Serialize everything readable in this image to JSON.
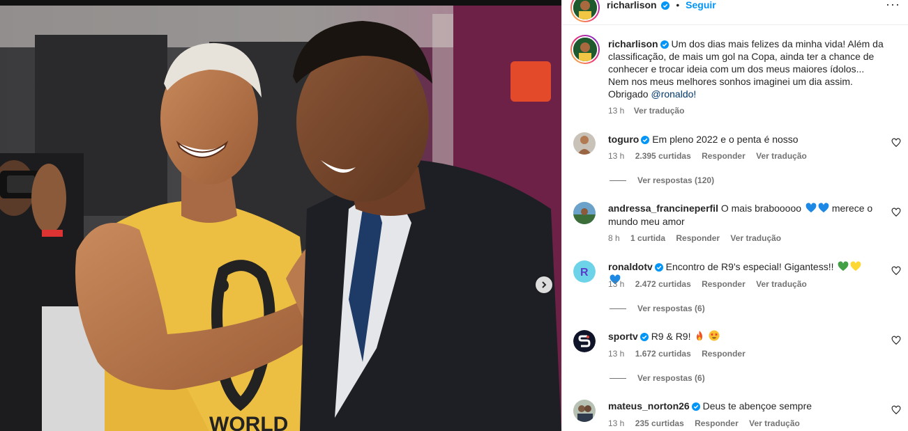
{
  "post": {
    "author": "richarlison",
    "follow_label": "Seguir",
    "caption": "Um dos dias mais felizes da minha vida! Além da classificação, de mais um gol na Copa, ainda ter a chance de conhecer e trocar ideia com um dos meus maiores ídolos... Nem nos meus melhores sonhos imaginei um dia assim. Obrigado",
    "mention": "@ronaldo!",
    "time": "13 h",
    "translate": "Ver tradução"
  },
  "comments": [
    {
      "user": "toguro",
      "text": "Em pleno 2022 e o penta é nosso",
      "time": "13 h",
      "likes": "2.395 curtidas",
      "reply": "Responder",
      "translate": "Ver tradução",
      "replies": "Ver respostas (120)"
    },
    {
      "user": "andressa_francineperfil",
      "text": "O mais brabooooo",
      "text_after": "merece o mundo meu amor",
      "time": "8 h",
      "likes": "1 curtida",
      "reply": "Responder",
      "translate": "Ver tradução"
    },
    {
      "user": "ronaldotv",
      "text": "Encontro de R9's especial! Gigantess!!",
      "time": "13 h",
      "likes": "2.472 curtidas",
      "reply": "Responder",
      "translate": "Ver tradução",
      "replies": "Ver respostas (6)"
    },
    {
      "user": "sportv",
      "text": "R9 & R9!",
      "time": "13 h",
      "likes": "1.672 curtidas",
      "reply": "Responder",
      "replies": "Ver respostas (6)"
    },
    {
      "user": "mateus_norton26",
      "text": "Deus te abençoe sempre",
      "time": "13 h",
      "likes": "235 curtidas",
      "reply": "Responder",
      "translate": "Ver tradução"
    }
  ],
  "colors": {
    "accent": "#0095f6",
    "verified": "#0095f6",
    "meta": "#737373"
  },
  "icons": [
    "verified-badge-icon",
    "more-options-icon",
    "heart-icon",
    "chevron-right-icon",
    "blue-heart-icon",
    "green-heart-icon",
    "yellow-heart-icon",
    "fire-emoji-icon",
    "star-struck-emoji-icon"
  ]
}
